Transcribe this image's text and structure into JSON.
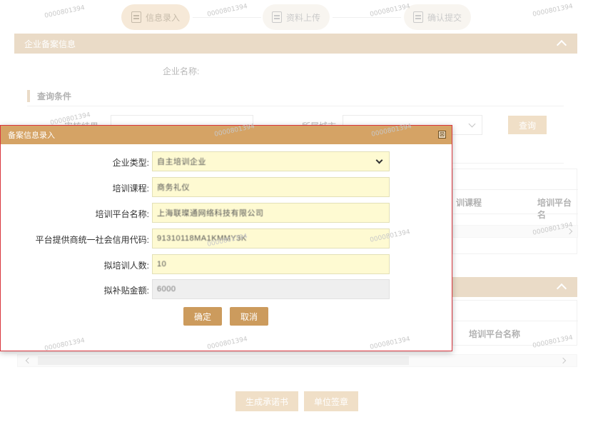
{
  "watermark": "0000801394",
  "steps": [
    {
      "label": "信息录入",
      "active": true
    },
    {
      "label": "资料上传",
      "active": false
    },
    {
      "label": "确认提交",
      "active": false
    }
  ],
  "company_section": {
    "title": "企业备案信息",
    "company_name_label": "企业名称:"
  },
  "query": {
    "title": "查询条件",
    "filter1_label": "审核结果",
    "filter2_label": "所属城市",
    "search_button": "查询"
  },
  "table_top": {
    "headers": [
      "训课程",
      "培训平台名"
    ]
  },
  "table_bottom": {
    "headers": [
      "培训平台名称"
    ]
  },
  "footer": {
    "commitment_button": "生成承诺书",
    "sign_button": "单位签章"
  },
  "modal": {
    "title": "备案信息录入",
    "close_icon_text": "⊠",
    "fields": [
      {
        "label": "企业类型:",
        "value": "自主培训企业",
        "type": "select"
      },
      {
        "label": "培训课程:",
        "value": "商务礼仪",
        "type": "input"
      },
      {
        "label": "培训平台名称:",
        "value": "上海联璨通网络科技有限公司",
        "type": "input"
      },
      {
        "label": "平台提供商统一社会信用代码:",
        "value": "91310118MA1KMMY3K",
        "type": "input"
      },
      {
        "label": "拟培训人数:",
        "value": "10",
        "type": "input"
      },
      {
        "label": "拟补贴金额:",
        "value": "6000",
        "type": "readonly"
      }
    ],
    "confirm_button": "确定",
    "cancel_button": "取消"
  },
  "colors": {
    "accent": "#c9a36f",
    "modal_header": "#d5a365",
    "modal_border": "#d9363e",
    "input_bg": "#fefad2"
  }
}
